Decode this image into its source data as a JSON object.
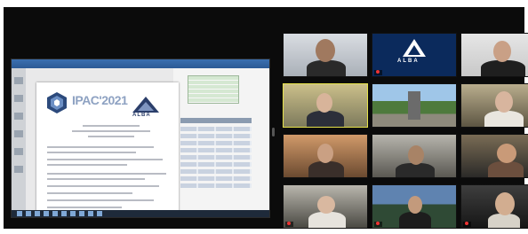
{
  "shared_screen": {
    "document_title": "IPAC'2021",
    "document_subtitle": "",
    "logo_text": "ALBA"
  },
  "gallery": {
    "tiles": [
      {
        "id": "t1",
        "caption": ""
      },
      {
        "id": "t2",
        "caption": "",
        "logo_text": "ALBA"
      },
      {
        "id": "t3",
        "caption": ""
      },
      {
        "id": "t4",
        "caption": "",
        "active": true
      },
      {
        "id": "t5",
        "caption": ""
      },
      {
        "id": "t6",
        "caption": ""
      },
      {
        "id": "t7",
        "caption": ""
      },
      {
        "id": "t8",
        "caption": ""
      },
      {
        "id": "t9",
        "caption": ""
      },
      {
        "id": "t10",
        "caption": ""
      },
      {
        "id": "t11",
        "caption": ""
      },
      {
        "id": "t12",
        "caption": ""
      }
    ]
  },
  "colors": {
    "background": "#0b0b0b",
    "active_speaker": "#e7e34a",
    "alba_blue": "#1d3a78"
  },
  "icons": {
    "mic_muted": "mic-muted-icon",
    "emblem": "ipac-emblem-icon",
    "alba_logo": "alba-logo-icon"
  }
}
